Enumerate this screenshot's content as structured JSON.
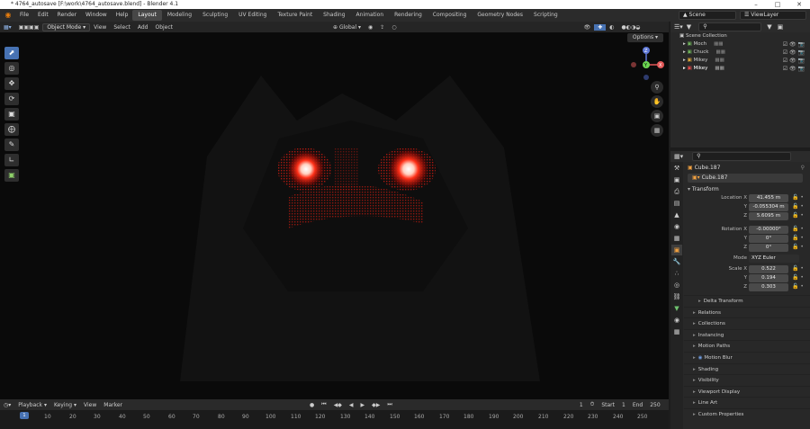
{
  "window": {
    "title": "* 4764_autosave [F:\\work\\4764_autosave.blend] - Blender 4.1"
  },
  "menubar": {
    "menus": [
      "File",
      "Edit",
      "Render",
      "Window",
      "Help"
    ],
    "workspaces": [
      "Layout",
      "Modeling",
      "Sculpting",
      "UV Editing",
      "Texture Paint",
      "Shading",
      "Animation",
      "Rendering",
      "Compositing",
      "Geometry Nodes",
      "Scripting"
    ],
    "active_workspace": "Layout",
    "scene": "Scene",
    "view_layer": "ViewLayer"
  },
  "viewport": {
    "mode": "Object Mode",
    "menus": [
      "View",
      "Select",
      "Add",
      "Object"
    ],
    "transform_orientation": "Global",
    "options_label": "Options",
    "axes": [
      "X",
      "Y",
      "Z"
    ],
    "accent_color": "#4772b3",
    "glow_color": "#ff2a1a"
  },
  "timeline": {
    "menus": [
      "Playback",
      "Keying",
      "View",
      "Marker"
    ],
    "current_frame": "1",
    "start_label": "Start",
    "start": "1",
    "end_label": "End",
    "end": "250",
    "ticks": [
      "10",
      "20",
      "30",
      "40",
      "50",
      "60",
      "70",
      "80",
      "90",
      "100",
      "110",
      "120",
      "130",
      "140",
      "150",
      "160",
      "170",
      "180",
      "190",
      "200",
      "210",
      "220",
      "230",
      "240",
      "250"
    ],
    "playhead": "1"
  },
  "outliner": {
    "search_placeholder": "",
    "root": "Scene Collection",
    "items": [
      {
        "label": "Moch"
      },
      {
        "label": "Chuck"
      },
      {
        "label": "Mikey"
      },
      {
        "label": "Mikey",
        "selected": true
      }
    ]
  },
  "properties": {
    "object_name": "Cube.187",
    "datablock_name": "Cube.187",
    "transform_header": "Transform",
    "location": {
      "label": "Location X",
      "x": "41.455 m",
      "y": "-0.055304 m",
      "z": "5.6095 m"
    },
    "rotation": {
      "label": "Rotation X",
      "x": "-0.00000°",
      "y": "0°",
      "z": "0°"
    },
    "mode": {
      "label": "Mode",
      "value": "XYZ Euler"
    },
    "scale": {
      "label": "Scale X",
      "x": "0.522",
      "y": "0.194",
      "z": "0.303"
    },
    "y_label": "Y",
    "z_label": "Z",
    "panels": [
      "Delta Transform",
      "Relations",
      "Collections",
      "Instancing",
      "Motion Paths",
      "Motion Blur",
      "Shading",
      "Visibility",
      "Viewport Display",
      "Line Art",
      "Custom Properties"
    ]
  }
}
